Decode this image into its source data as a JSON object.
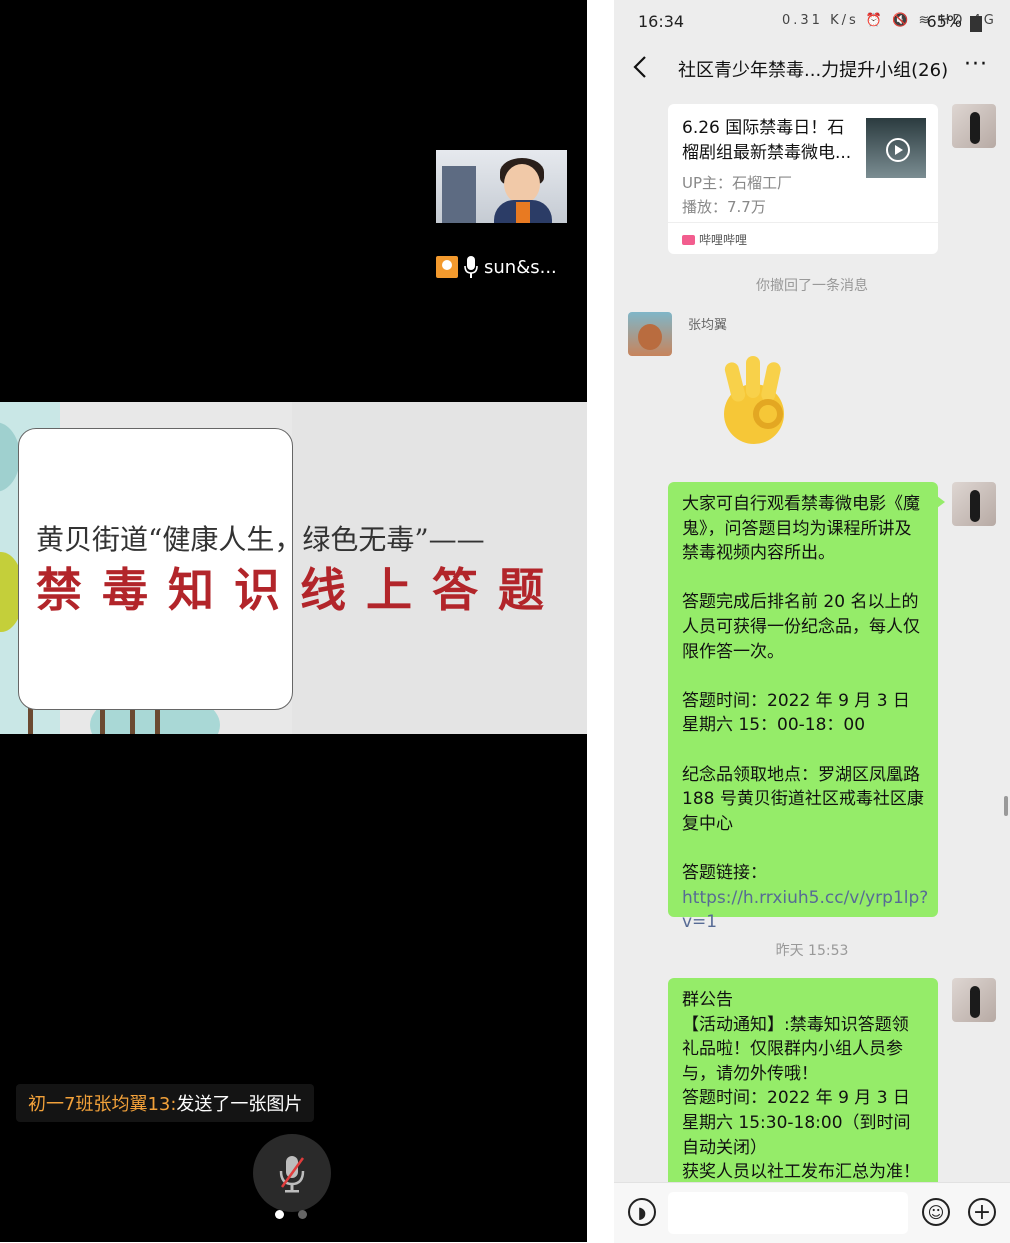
{
  "meeting": {
    "participant_name": "sun&s...",
    "slide": {
      "line1": "黄贝街道“健康人生，绿色无毒”——",
      "line2": "禁毒知识线上答题"
    },
    "chat_notice": {
      "sender": "初一7班张均翼13:",
      "text": " 发送了一张图片"
    },
    "page_dots": 2,
    "active_dot": 0
  },
  "phone": {
    "status": {
      "time": "16:34",
      "net_speed": "0.31 K/s",
      "signal": "HD 4G",
      "battery": "65%"
    },
    "chat_title": "社区青少年禁毒...力提升小组(26)",
    "more_label": "···",
    "link_card": {
      "title": "6.26 国际禁毒日！石榴剧组最新禁毒微电...",
      "up": "UP主：石榴工厂",
      "plays": "播放：7.7万",
      "source": "哔哩哔哩"
    },
    "recall_notice": "你撤回了一条消息",
    "sender_name": "张均翼",
    "msg1": {
      "p1": "大家可自行观看禁毒微电影《魔鬼》，问答题目均为课程所讲及禁毒视频内容所出。",
      "p2": "答题完成后排名前 20 名以上的人员可获得一份纪念品，每人仅限作答一次。",
      "p3": "答题时间：2022 年 9 月 3 日星期六 15：00-18：00",
      "p4": "纪念品领取地点：罗湖区凤凰路 188 号黄贝街道社区戒毒社区康复中心",
      "p5_label": "答题链接：",
      "p5_url": "https://h.rrxiuh5.cc/v/yrp1lp?v=1"
    },
    "timestamp": "昨天 15:53",
    "msg2": {
      "l1": "群公告",
      "l2": "【活动通知】:禁毒知识答题领礼品啦！仅限群内小组人员参与，请勿外传哦！",
      "l3": "答题时间：2022 年 9 月 3 日星期六 15:30-18:00（到时间自动关闭）",
      "l4": "获奖人员以社工发布汇总为准！"
    }
  },
  "colors": {
    "bubble_green": "#95ec69",
    "slide_red": "#b2252a",
    "chat_bg": "#ededed"
  }
}
